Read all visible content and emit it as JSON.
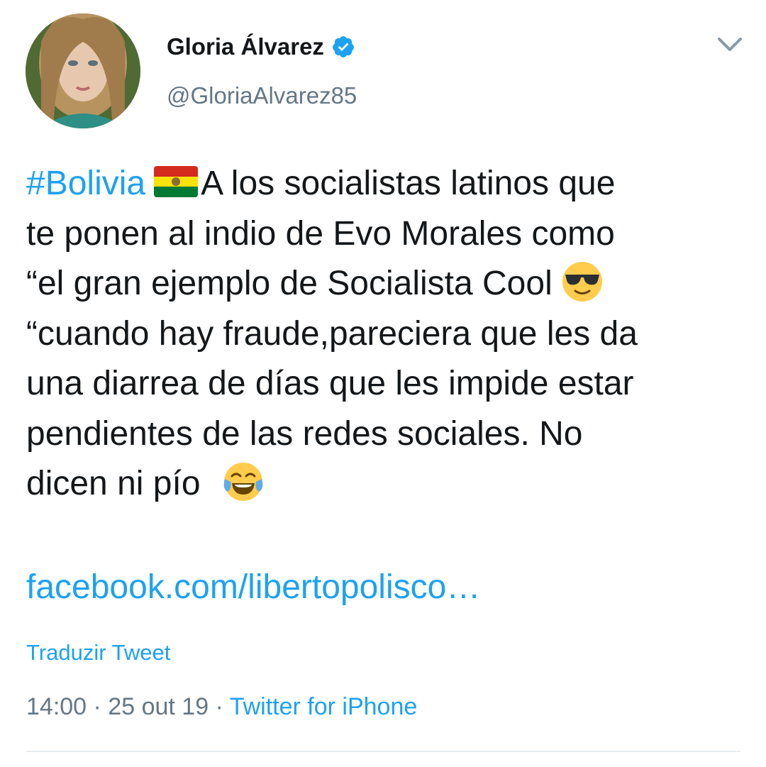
{
  "author": {
    "name": "Gloria Álvarez",
    "handle": "@GloriaAlvarez85"
  },
  "tweet": {
    "hashtag": "#Bolivia",
    "line1_text": "A los socialistas latinos que",
    "line2": "te ponen al indio de Evo Morales como",
    "line3_text": "“el gran ejemplo de Socialista Cool",
    "line4": "“cuando hay fraude,pareciera que les da",
    "line5": "una diarrea de días que les impide estar",
    "line6": "pendientes de las redes sociales. No",
    "line7_text": "dicen ni pío",
    "link": "facebook.com/libertopolisco…"
  },
  "translate_label": "Traduzir Tweet",
  "meta": {
    "time": "14:00",
    "separator1": " · ",
    "date": "25 out 19",
    "separator2": " · ",
    "source": "Twitter for iPhone"
  },
  "icons": {
    "verified": "verified-badge-icon",
    "caret": "chevron-down-icon",
    "flag": "bolivia-flag-emoji",
    "cool": "sunglasses-face-emoji",
    "laugh": "tears-of-joy-emoji"
  },
  "colors": {
    "link": "#1da1f2",
    "text": "#14171a",
    "secondary": "#657786",
    "divider": "#e6ecf0"
  }
}
